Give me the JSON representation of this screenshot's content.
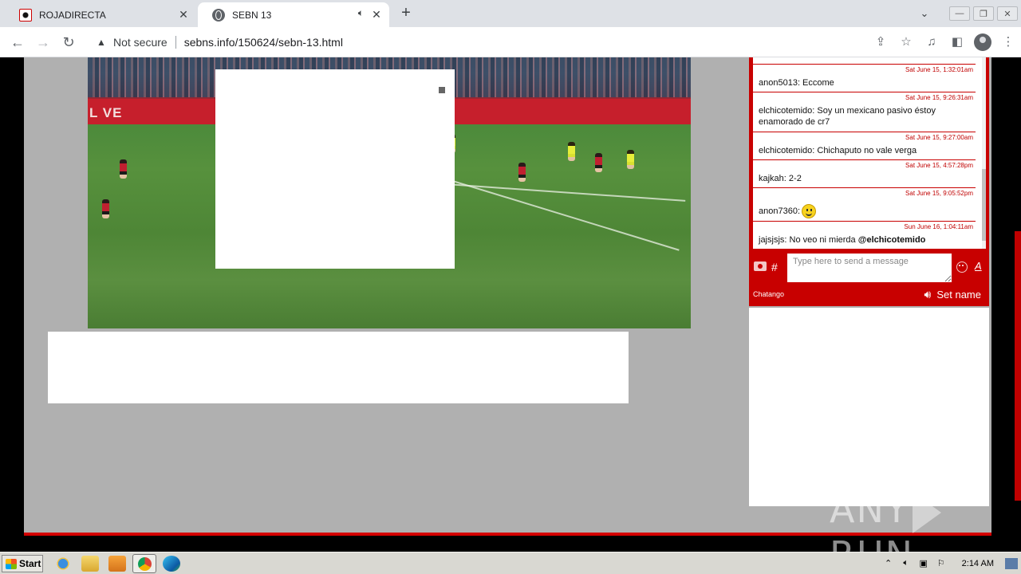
{
  "browser": {
    "tabs": [
      {
        "title": "ROJADIRECTA",
        "active": false
      },
      {
        "title": "SEBN 13",
        "active": true,
        "audio": true
      }
    ],
    "new_tab": "+",
    "not_secure": "Not secure",
    "url": "sebns.info/150624/sebn-13.html"
  },
  "video": {
    "banner_text": "L VE"
  },
  "chat": {
    "messages": [
      {
        "ts": "Sat June 15, 1:32:01am",
        "text": "anon5013: Eccome"
      },
      {
        "ts": "Sat June 15, 9:26:31am",
        "text": "elchicotemido: Soy un mexicano pasivo éstoy enamorado de cr7"
      },
      {
        "ts": "Sat June 15, 9:27:00am",
        "text": "elchicotemido: Chichaputo no vale verga"
      },
      {
        "ts": "Sat June 15, 4:57:28pm",
        "text": "kajkah: 2-2"
      },
      {
        "ts": "Sat June 15, 9:05:52pm",
        "text": "anon7360:"
      },
      {
        "ts": "Sun June 16, 1:04:11am",
        "text": "jajsjsjs: No veo ni mierda ",
        "mention": "@elchicotemido"
      }
    ],
    "hash": "#",
    "input_placeholder": "Type here to send a message",
    "font_button": "A",
    "brand": "Chatango",
    "set_name": "Set name"
  },
  "watermark": {
    "left": "ANY",
    "right": "RUN"
  },
  "taskbar": {
    "start": "Start",
    "clock": "2:14 AM"
  },
  "colors": {
    "chat_red": "#c80000",
    "page_gray": "#b0b0b0"
  }
}
